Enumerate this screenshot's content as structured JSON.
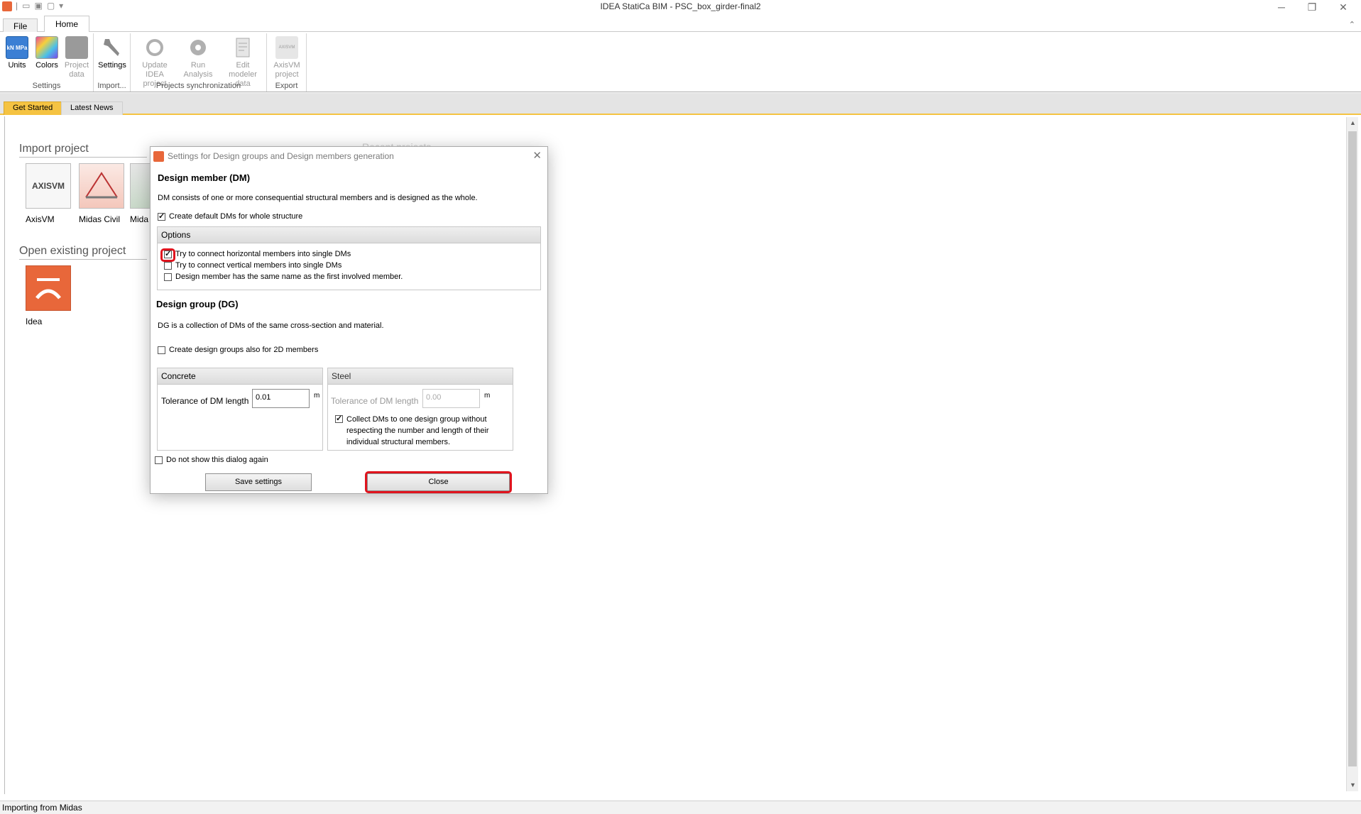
{
  "window": {
    "title": "IDEA StatiCa BIM - PSC_box_girder-final2"
  },
  "ribbon_tabs": {
    "file": "File",
    "home": "Home"
  },
  "ribbon": {
    "groups": {
      "settings": "Settings",
      "import": "Import...",
      "sync": "Projects synchronization",
      "export": "Export"
    },
    "buttons": {
      "units": "Units",
      "colors": "Colors",
      "project_data": "Project data",
      "settings": "Settings",
      "update_idea": "Update IDEA project",
      "run_analysis": "Run Analysis",
      "edit_modeler": "Edit modeler data",
      "axisvm_project": "AxisVM project"
    },
    "units_icon_text": "kN MPa",
    "axisvm_icon_text": "AXISVM"
  },
  "doc_tabs": {
    "get_started": "Get Started",
    "latest_news": "Latest News"
  },
  "main": {
    "import_title": "Import project",
    "open_title": "Open existing project",
    "tiles": {
      "axisvm": "AxisVM",
      "midas_civil": "Midas Civil",
      "midas_gen": "Mida",
      "idea": "Idea"
    },
    "axisvm_logo": "AXISVM",
    "hidden_heading": "Recent projects"
  },
  "dialog": {
    "title": "Settings for Design groups and Design members generation",
    "dm_heading": "Design member (DM)",
    "dm_desc": "DM consists of one or more consequential structural members and is designed as the whole.",
    "create_default_dms": "Create default DMs for whole structure",
    "options_header": "Options",
    "opt_horizontal": "Try to connect horizontal members into single DMs",
    "opt_vertical": "Try to connect vertical members into single DMs",
    "opt_same_name": "Design member has the same name as the first involved member.",
    "dg_heading": "Design group (DG)",
    "dg_desc": "DG is a collection of DMs of the same cross-section and material.",
    "create_dg_2d": "Create design groups also for 2D members",
    "concrete": {
      "header": "Concrete",
      "tol_label": "Tolerance of DM length",
      "tol_value": "0.01",
      "unit": "m"
    },
    "steel": {
      "header": "Steel",
      "tol_label": "Tolerance of DM length",
      "tol_value": "0.00",
      "unit": "m",
      "collect": "Collect DMs to one design group without respecting the number and length of their individual structural members."
    },
    "do_not_show": "Do not show this dialog again",
    "save_button": "Save settings",
    "close_button": "Close"
  },
  "status": {
    "text": "Importing from Midas"
  },
  "colors": {
    "accent": "#f5c342",
    "brand": "#e8673a",
    "highlight": "#e0141e"
  }
}
